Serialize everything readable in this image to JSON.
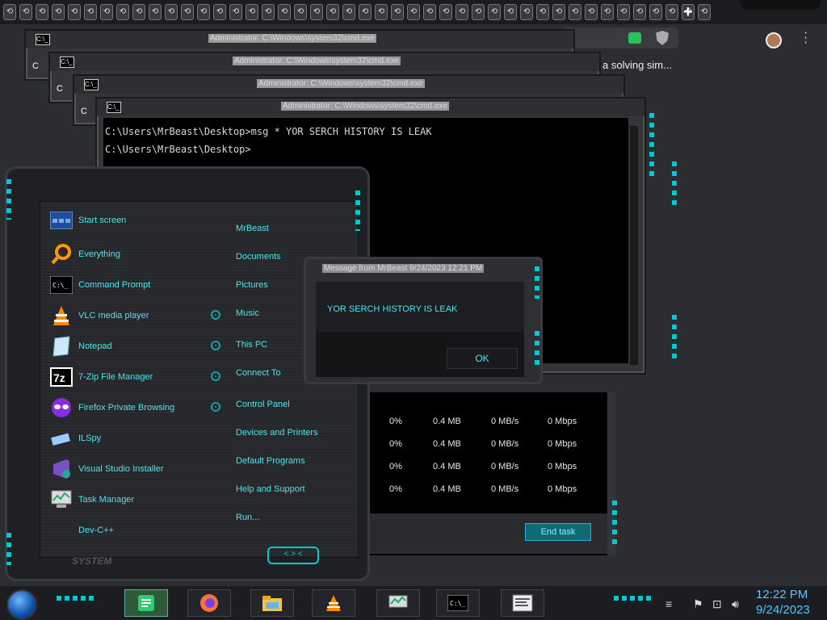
{
  "browser": {
    "new_tab": "+",
    "bg_text": "a solving sim..."
  },
  "cmd_windows": [
    {
      "title": "Administrator: C:\\Windows\\system32\\cmd.exe"
    },
    {
      "title": "Administrator: C:\\Windows\\system32\\cmd.exe"
    },
    {
      "title": "Administrator: C:\\Windows\\system32\\cmd.exe"
    },
    {
      "title": "Administrator: C:\\Windows\\system32\\cmd.exe"
    }
  ],
  "cmd": {
    "line1": "C:\\Users\\MrBeast\\Desktop>msg * YOR SERCH HISTORY IS LEAK",
    "line2": "C:\\Users\\MrBeast\\Desktop>",
    "icon": "C:\\_",
    "edge_letter": "C"
  },
  "start_menu": {
    "left_items": [
      {
        "label": "Start screen",
        "icon": "start-screen-icon"
      },
      {
        "label": "Everything",
        "icon": "everything-search-icon"
      },
      {
        "label": "Command Prompt",
        "icon": "command-prompt-icon"
      },
      {
        "label": "VLC media player",
        "icon": "vlc-cone-icon"
      },
      {
        "label": "Notepad",
        "icon": "notepad-icon"
      },
      {
        "label": "7-Zip File Manager",
        "icon": "7zip-icon"
      },
      {
        "label": "Firefox Private Browsing",
        "icon": "firefox-private-icon"
      },
      {
        "label": "ILSpy",
        "icon": "ilspy-icon"
      },
      {
        "label": "Visual Studio Installer",
        "icon": "visual-studio-icon"
      },
      {
        "label": "Task Manager",
        "icon": "task-manager-icon"
      },
      {
        "label": "Dev-C++",
        "icon": ""
      }
    ],
    "right_items": [
      "MrBeast",
      "Documents",
      "Pictures",
      "Music",
      "This PC",
      "Connect To",
      "Control Panel",
      "Devices and Printers",
      "Default Programs",
      "Help and Support",
      "Run..."
    ],
    "system_label": "SYSTEM",
    "nav_label": "< > <"
  },
  "task_manager": {
    "rows": [
      {
        "cpu": "0%",
        "mem": "0.4 MB",
        "disk": "0 MB/s",
        "net": "0 Mbps"
      },
      {
        "cpu": "0%",
        "mem": "0.4 MB",
        "disk": "0 MB/s",
        "net": "0 Mbps"
      },
      {
        "cpu": "0%",
        "mem": "0.4 MB",
        "disk": "0 MB/s",
        "net": "0 Mbps"
      },
      {
        "cpu": "0%",
        "mem": "0.4 MB",
        "disk": "0 MB/s",
        "net": "0 Mbps"
      }
    ],
    "end_task": "End task"
  },
  "dialog": {
    "title": "Message from MrBeast 9/24/2023 12:21 PM",
    "message": "YOR SERCH HISTORY IS LEAK",
    "ok": "OK"
  },
  "taskbar": {
    "time": "12:22 PM",
    "date": "9/24/2023"
  },
  "colors": {
    "accent_cyan": "#00c8d4",
    "text_cyan": "#49e5f0",
    "clock_blue": "#56c4ff"
  }
}
